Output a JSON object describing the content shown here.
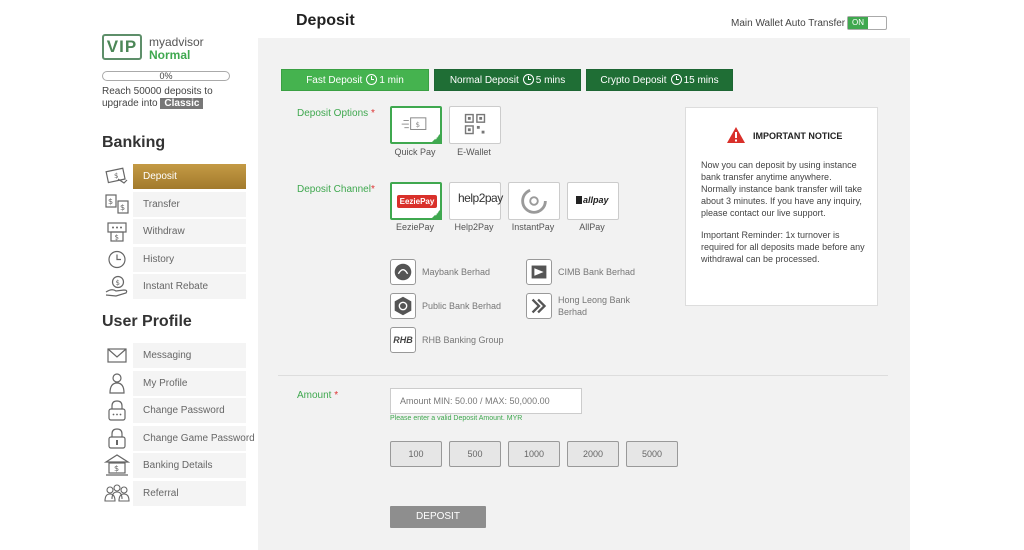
{
  "user": {
    "vip_badge": "VIP",
    "name": "myadvisor",
    "level": "Normal",
    "progress_percent": 0,
    "progress_label": "0%",
    "upgrade_text": "Reach 50000 deposits to upgrade into",
    "next_tier": "Classic"
  },
  "sidebar": {
    "banking_title": "Banking",
    "banking_items": [
      {
        "label": "Deposit",
        "icon": "deposit-icon",
        "active": true
      },
      {
        "label": "Transfer",
        "icon": "transfer-icon",
        "active": false
      },
      {
        "label": "Withdraw",
        "icon": "withdraw-icon",
        "active": false
      },
      {
        "label": "History",
        "icon": "history-icon",
        "active": false
      },
      {
        "label": "Instant Rebate",
        "icon": "rebate-icon",
        "active": false
      }
    ],
    "profile_title": "User Profile",
    "profile_items": [
      {
        "label": "Messaging",
        "icon": "envelope-icon"
      },
      {
        "label": "My Profile",
        "icon": "person-icon"
      },
      {
        "label": "Change Password",
        "icon": "lock-icon"
      },
      {
        "label": "Change Game Password",
        "icon": "lock-game-icon"
      },
      {
        "label": "Banking Details",
        "icon": "bank-building-icon"
      },
      {
        "label": "Referral",
        "icon": "group-icon"
      }
    ]
  },
  "header": {
    "title": "Deposit",
    "auto_transfer_label": "Main Wallet Auto Transfer",
    "auto_transfer_state": "ON"
  },
  "tabs": [
    {
      "label": "Fast Deposit",
      "time": "1 min",
      "active": true
    },
    {
      "label": "Normal Deposit",
      "time": "5 mins",
      "active": false
    },
    {
      "label": "Crypto Deposit",
      "time": "15 mins",
      "active": false
    }
  ],
  "deposit_options": {
    "label": "Deposit Options",
    "required": "*",
    "items": [
      {
        "label": "Quick Pay",
        "selected": true
      },
      {
        "label": "E-Wallet",
        "selected": false
      }
    ]
  },
  "deposit_channel": {
    "label": "Deposit Channel",
    "required": "*",
    "items": [
      {
        "label": "EeziePay",
        "logo_text": "EeziePay",
        "selected": true
      },
      {
        "label": "Help2Pay",
        "logo_text": "help2pay",
        "selected": false
      },
      {
        "label": "InstantPay",
        "logo_text": "",
        "selected": false
      },
      {
        "label": "AllPay",
        "logo_text": "allpay",
        "selected": false
      }
    ]
  },
  "banks": [
    {
      "name": "Maybank Berhad"
    },
    {
      "name": "CIMB Bank Berhad"
    },
    {
      "name": "Public Bank Berhad"
    },
    {
      "name": "Hong Leong Bank Berhad"
    },
    {
      "name": "RHB Banking Group",
      "logo_text": "RHB"
    }
  ],
  "notice": {
    "title": "IMPORTANT NOTICE",
    "paragraph1": "Now you can deposit by using instance bank transfer anytime anywhere. Normally instance bank transfer will take about 3 minutes. If you have any inquiry, please contact our live support.",
    "paragraph2": "Important Reminder: 1x turnover is required for all deposits made before any withdrawal can be processed."
  },
  "amount": {
    "label": "Amount",
    "required": "*",
    "placeholder": "Amount MIN: 50.00 / MAX: 50,000.00",
    "hint": "Please enter a valid Deposit Amount. MYR",
    "quick_amounts": [
      "100",
      "500",
      "1000",
      "2000",
      "5000"
    ]
  },
  "submit_label": "DEPOSIT",
  "colors": {
    "brand_green": "#3fa84f",
    "dark_green": "#1f6e35",
    "active_gold": "#b08a3a"
  }
}
